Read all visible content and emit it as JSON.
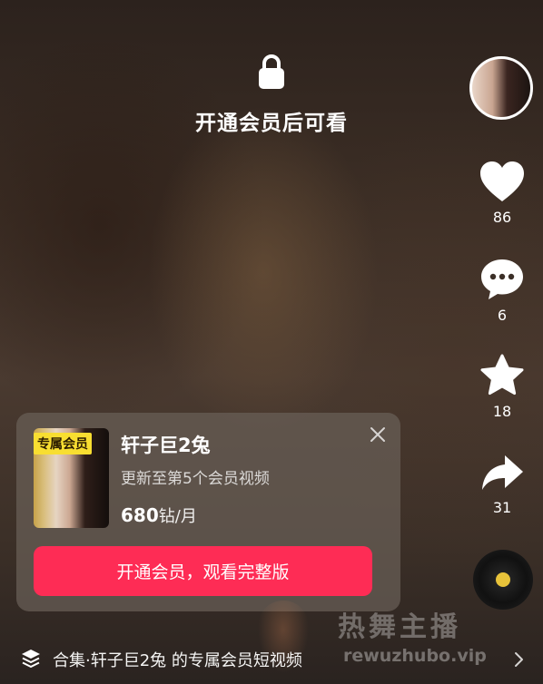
{
  "lock_overlay": {
    "icon": "lock-icon",
    "text": "开通会员后可看"
  },
  "rail": {
    "like_count": "86",
    "comment_count": "6",
    "favorite_count": "18",
    "share_count": "31"
  },
  "card": {
    "badge": "专属会员",
    "title": "轩子巨2兔",
    "subtitle": "更新至第5个会员视频",
    "price_value": "680",
    "price_unit": "钻/月",
    "join_button": "开通会员，观看完整版"
  },
  "watermark": {
    "title": "热舞主播",
    "url": "rewuzhubo.vip"
  },
  "collection": {
    "text": "合集·轩子巨2兔 的专属会员短视频"
  },
  "colors": {
    "accent": "#fe2c55",
    "badge": "#f8de31",
    "disc_dot": "#e8c33a"
  }
}
